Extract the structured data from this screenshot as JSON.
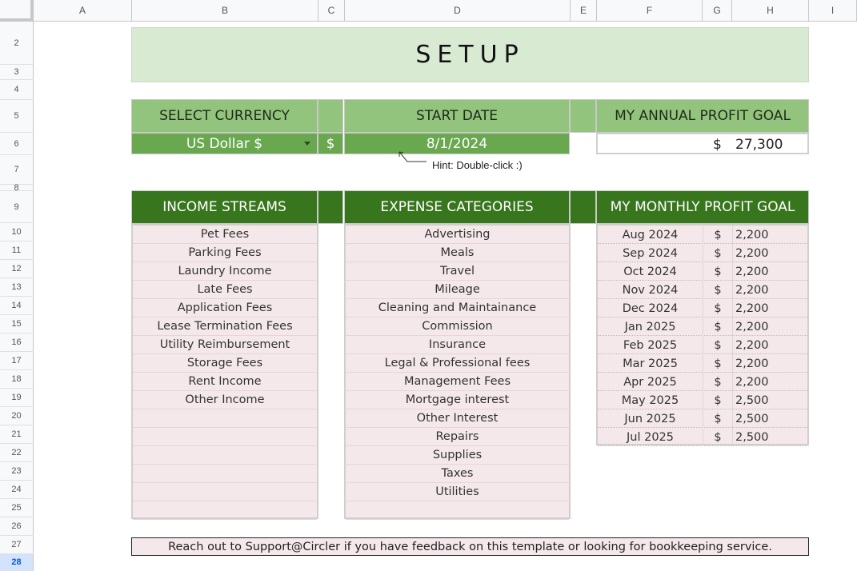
{
  "columns": [
    "A",
    "B",
    "C",
    "D",
    "E",
    "F",
    "G",
    "H",
    "I"
  ],
  "rows": [
    "2",
    "3",
    "4",
    "5",
    "6",
    "7",
    "8",
    "9",
    "10",
    "11",
    "12",
    "13",
    "14",
    "15",
    "16",
    "17",
    "18",
    "19",
    "20",
    "21",
    "22",
    "23",
    "24",
    "25",
    "26",
    "27",
    "28"
  ],
  "title": "SETUP",
  "currency": {
    "header": "SELECT CURRENCY",
    "value": "US Dollar $",
    "symbol": "$"
  },
  "start_date": {
    "header": "START DATE",
    "value": "8/1/2024",
    "hint": "Hint: Double-click :)"
  },
  "annual_goal": {
    "header": "MY ANNUAL PROFIT GOAL",
    "symbol": "$",
    "value": "27,300"
  },
  "income": {
    "header": "INCOME STREAMS",
    "items": [
      "Pet Fees",
      "Parking Fees",
      "Laundry Income",
      "Late Fees",
      "Application Fees",
      "Lease Termination Fees",
      "Utility Reimbursement",
      "Storage Fees",
      "Rent Income",
      "Other Income"
    ]
  },
  "expenses": {
    "header": "EXPENSE CATEGORIES",
    "items": [
      "Advertising",
      "Meals",
      "Travel",
      "Mileage",
      "Cleaning and Maintainance",
      "Commission",
      "Insurance",
      "Legal & Professional fees",
      "Management Fees",
      "Mortgage interest",
      "Other Interest",
      "Repairs",
      "Supplies",
      "Taxes",
      "Utilities"
    ]
  },
  "monthly_goal": {
    "header": "MY MONTHLY PROFIT GOAL",
    "rows": [
      {
        "month": "Aug 2024",
        "cur": "$",
        "amount": "2,200"
      },
      {
        "month": "Sep 2024",
        "cur": "$",
        "amount": "2,200"
      },
      {
        "month": "Oct 2024",
        "cur": "$",
        "amount": "2,200"
      },
      {
        "month": "Nov 2024",
        "cur": "$",
        "amount": "2,200"
      },
      {
        "month": "Dec 2024",
        "cur": "$",
        "amount": "2,200"
      },
      {
        "month": "Jan 2025",
        "cur": "$",
        "amount": "2,200"
      },
      {
        "month": "Feb 2025",
        "cur": "$",
        "amount": "2,200"
      },
      {
        "month": "Mar 2025",
        "cur": "$",
        "amount": "2,200"
      },
      {
        "month": "Apr 2025",
        "cur": "$",
        "amount": "2,200"
      },
      {
        "month": "May 2025",
        "cur": "$",
        "amount": "2,500"
      },
      {
        "month": "Jun 2025",
        "cur": "$",
        "amount": "2,500"
      },
      {
        "month": "Jul 2025",
        "cur": "$",
        "amount": "2,500"
      }
    ]
  },
  "footer": "Reach out to Support@Circler if you have feedback on this template or looking for bookkeeping service.",
  "colors": {
    "title_bg": "#d9ead3",
    "header_light": "#93c47d",
    "header_dark": "#38761d",
    "value_bg": "#6aa84f",
    "list_bg": "#f4e8ea"
  },
  "icons": {
    "dropdown": "dropdown-arrow-icon"
  }
}
